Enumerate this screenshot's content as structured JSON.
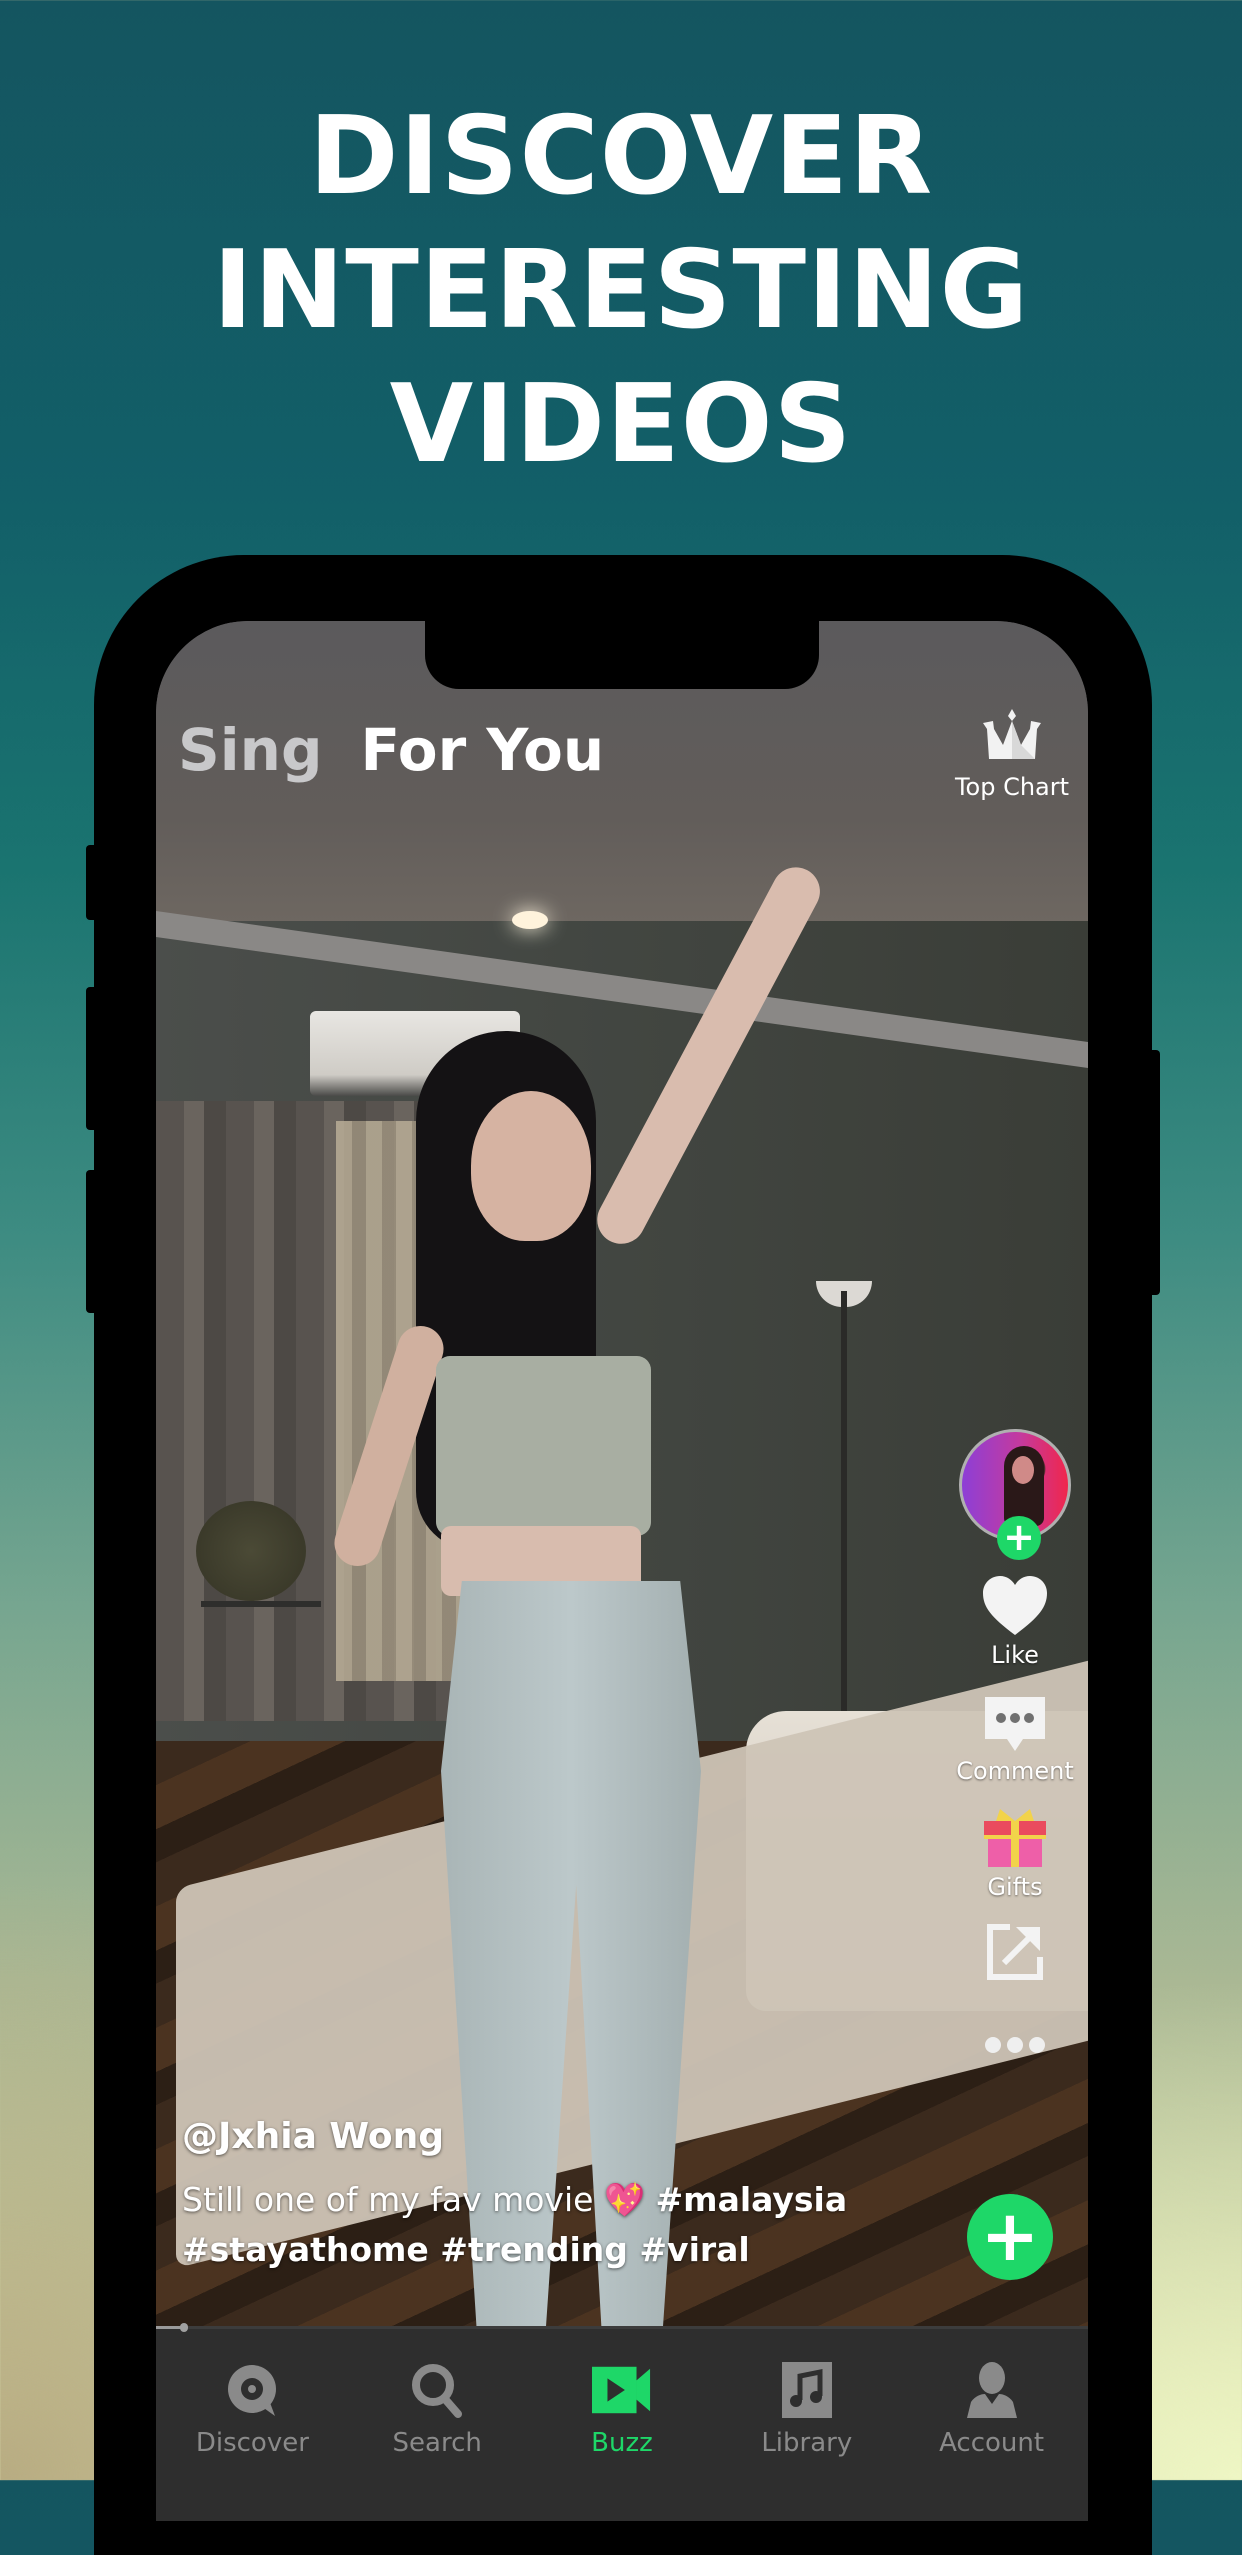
{
  "headline": {
    "lines": [
      "DISCOVER",
      "INTERESTING",
      "VIDEOS"
    ]
  },
  "top_tabs": [
    {
      "label": "Sing",
      "active": false
    },
    {
      "label": "For You",
      "active": true
    }
  ],
  "top_chart": {
    "label": "Top Chart",
    "icon": "crown-icon"
  },
  "side_rail": {
    "avatar_follow_icon": "plus-icon",
    "items": [
      {
        "label": "Like",
        "icon": "heart-icon"
      },
      {
        "label": "Comment",
        "icon": "comment-icon"
      },
      {
        "label": "Gifts",
        "icon": "gift-icon"
      },
      {
        "label": "",
        "icon": "share-icon"
      },
      {
        "label": "",
        "icon": "more-icon"
      }
    ]
  },
  "post": {
    "handle": "@Jxhia Wong",
    "caption_text": "Still one of my fav movie",
    "caption_emoji": "💖",
    "hashtags_line1": "#malaysia",
    "hashtags_line2": "#stayathome #trending #viral"
  },
  "create_button": {
    "icon": "plus-icon",
    "label": "+"
  },
  "follow_label": "+",
  "playback": {
    "progress_fraction": 0.03
  },
  "bottom_nav": {
    "items": [
      {
        "label": "Discover",
        "icon": "discover-icon",
        "active": false
      },
      {
        "label": "Search",
        "icon": "search-icon",
        "active": false
      },
      {
        "label": "Buzz",
        "icon": "video-icon",
        "active": true
      },
      {
        "label": "Library",
        "icon": "music-library-icon",
        "active": false
      },
      {
        "label": "Account",
        "icon": "account-icon",
        "active": false
      }
    ]
  },
  "colors": {
    "accent": "#1ED768",
    "nav_bg": "#2E2E2E",
    "nav_inactive": "#8A8A8A",
    "gift_red": "#EA4B5E",
    "gift_pink": "#EE5FA8",
    "gift_ribbon": "#F2D34A"
  }
}
